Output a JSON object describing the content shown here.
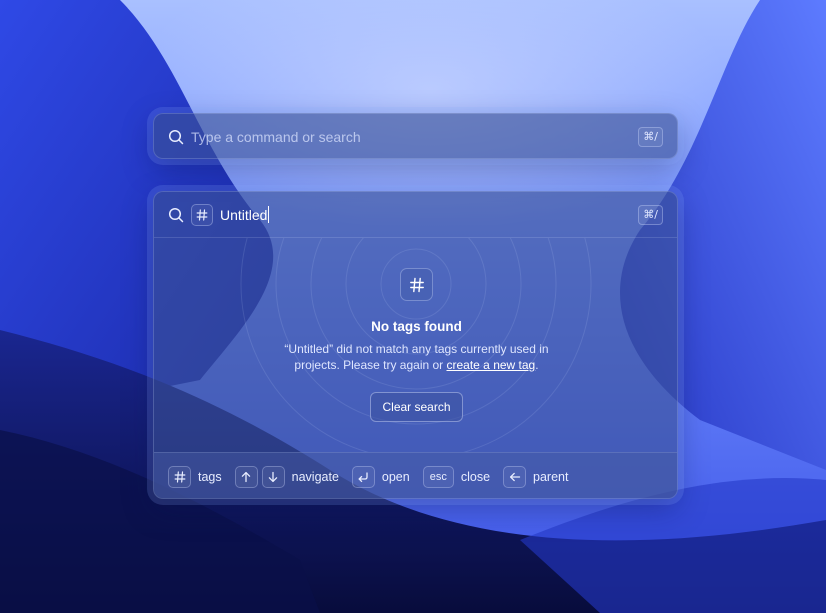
{
  "colors": {
    "wallpaper_top": "#9fb8ff",
    "wallpaper_mid": "#4160f0",
    "wallpaper_dark": "#10186a",
    "panel": "#3a5096",
    "text": "#e8edff"
  },
  "top_bar": {
    "search_icon": "search-icon",
    "placeholder": "Type a command or search",
    "shortcut": "⌘/"
  },
  "panel": {
    "search_icon": "search-icon",
    "filter_icon": "hash-icon",
    "query": "Untitled",
    "shortcut": "⌘/",
    "empty_state": {
      "icon": "hash-icon",
      "title": "No tags found",
      "description_prefix": "“Untitled” did not match any tags currently used in projects. Please try again or ",
      "link_text": "create a new tag",
      "description_suffix": ".",
      "clear_button": "Clear search"
    },
    "footer": {
      "tags_icon": "hash-icon",
      "tags_label": "tags",
      "navigate_label": "navigate",
      "open_label": "open",
      "close_key": "esc",
      "close_label": "close",
      "parent_label": "parent"
    }
  }
}
